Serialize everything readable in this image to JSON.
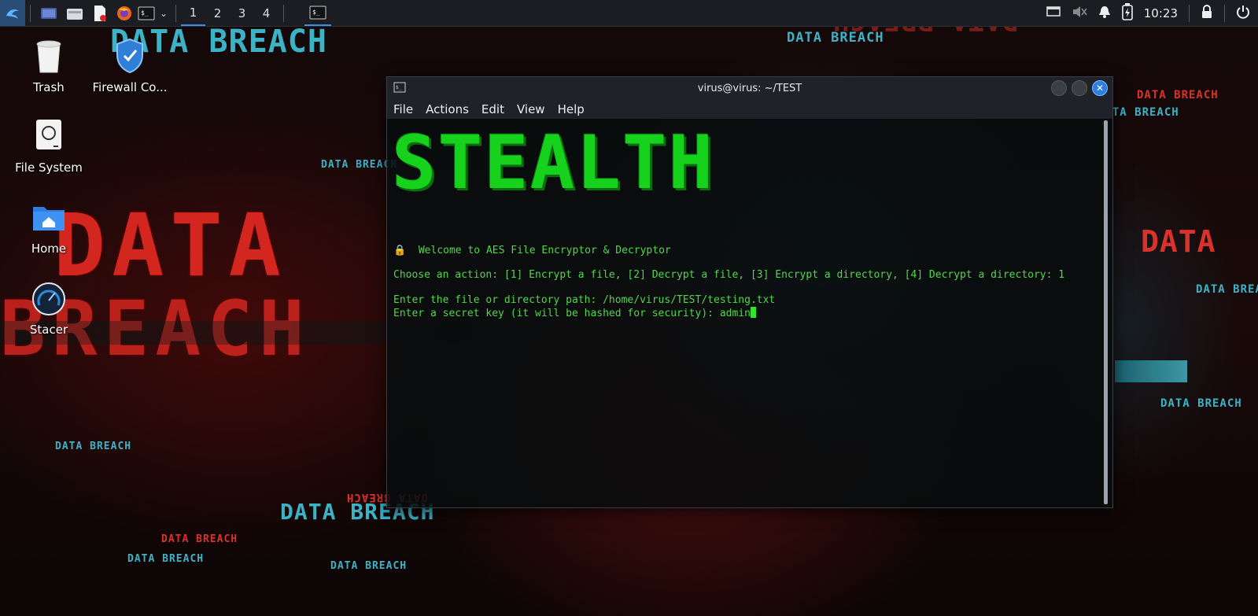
{
  "taskbar": {
    "workspaces": [
      "1",
      "2",
      "3",
      "4"
    ],
    "active_workspace": "1",
    "clock": "10:23",
    "icons": [
      "kali-menu-icon",
      "show-desktop-icon",
      "file-manager-icon",
      "text-editor-icon",
      "firefox-icon",
      "terminal-icon",
      "chevron-down-icon"
    ],
    "tray_icons": [
      "display-icon",
      "mute-icon",
      "bell-icon",
      "battery-icon",
      "lock-icon",
      "power-icon"
    ]
  },
  "desktop": {
    "icons": [
      {
        "label": "Trash",
        "icon": "trash-icon"
      },
      {
        "label": "Firewall Co...",
        "icon": "shield-icon"
      },
      {
        "label": "File System",
        "icon": "drive-icon"
      },
      {
        "label": "Home",
        "icon": "home-folder-icon"
      },
      {
        "label": "Stacer",
        "icon": "stacer-icon"
      }
    ],
    "wallpaper_text": {
      "data_breach": "DATA BREACH",
      "big_data": "DATA",
      "big_breach": "BREACH",
      "mirrored": "DATA BREACH"
    }
  },
  "terminal": {
    "title": "virus@virus: ~/TEST",
    "menu": [
      "File",
      "Actions",
      "Edit",
      "View",
      "Help"
    ],
    "banner": "STEALTH",
    "lines": {
      "welcome": "🔒  Welcome to AES File Encryptor & Decryptor",
      "choose": "Choose an action: [1] Encrypt a file, [2] Decrypt a file, [3] Encrypt a directory, [4] Decrypt a directory: 1",
      "path": "Enter the file or directory path: /home/virus/TEST/testing.txt",
      "key": "Enter a secret key (it will be hashed for security): admin"
    }
  },
  "colors": {
    "terminal_text": "#4fd84a",
    "banner": "#16d21c",
    "accent": "#2d7fe0"
  }
}
